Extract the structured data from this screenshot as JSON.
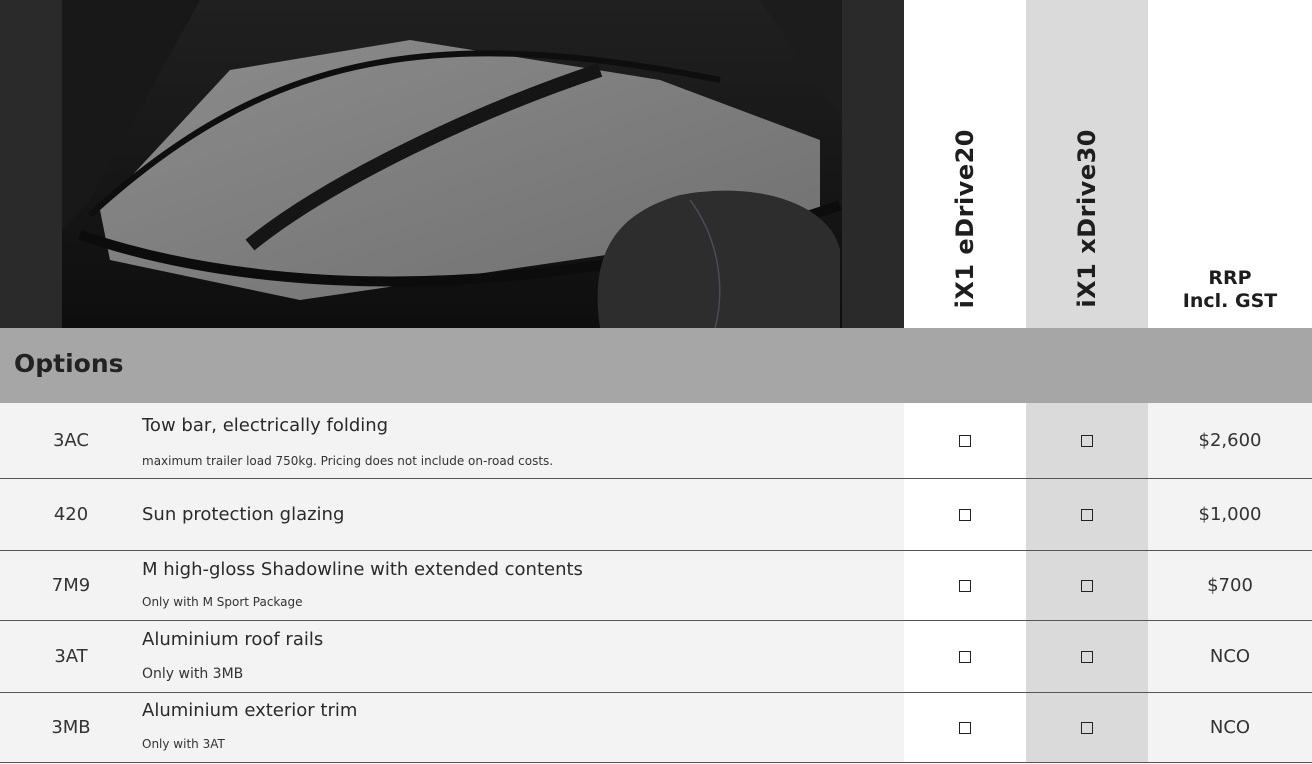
{
  "columns": {
    "model1": "iX1 eDrive20",
    "model2": "iX1 xDrive30",
    "price_line1": "RRP",
    "price_line2": "Incl. GST"
  },
  "section": {
    "title": "Options"
  },
  "rows": [
    {
      "code": "3AC",
      "title": "Tow bar, electrically folding",
      "note": "maximum trailer load 750kg. Pricing does not include on-road costs.",
      "price": "$2,600"
    },
    {
      "code": "420",
      "title": "Sun protection glazing",
      "note": "",
      "price": "$1,000"
    },
    {
      "code": "7M9",
      "title": "M high-gloss Shadowline with extended contents",
      "note": "Only with M Sport Package",
      "price": "$700"
    },
    {
      "code": "3AT",
      "title": "Aluminium roof rails",
      "note": "Only with 3MB",
      "price": "NCO"
    },
    {
      "code": "3MB",
      "title": "Aluminium exterior trim",
      "note": "Only with 3AT",
      "price": "NCO"
    }
  ],
  "colors": {
    "section_bg": "#a6a6a6",
    "xdrive_col_bg": "#dadada",
    "row_bg": "#f3f3f3"
  }
}
